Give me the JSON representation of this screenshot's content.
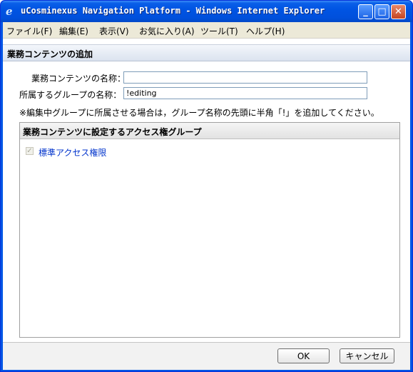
{
  "window": {
    "title": "uCosminexus Navigation Platform - Windows Internet Explorer",
    "minimize_glyph": "_",
    "maximize_glyph": "□",
    "close_glyph": "✕",
    "icon": "ie-icon"
  },
  "menubar": {
    "items": [
      "ファイル(F)",
      "編集(E)",
      "表示(V)",
      "お気に入り(A)",
      "ツール(T)",
      "ヘルプ(H)"
    ]
  },
  "dialog": {
    "title": "業務コンテンツの追加",
    "name_label": "業務コンテンツの名称：",
    "name_value": "",
    "group_label": "所属するグループの名称：",
    "group_value": "!editing",
    "note": "※編集中グループに所属させる場合は，グループ名称の先頭に半角「!」を追加してください。"
  },
  "access": {
    "header": "業務コンテンツに設定するアクセス権グループ",
    "items": [
      {
        "label": "標準アクセス権限",
        "checked": true,
        "disabled": true
      }
    ]
  },
  "footer": {
    "ok_label": "OK",
    "cancel_label": "キャンセル"
  },
  "colors": {
    "titlebar": "#0054e3",
    "link": "#0033cc"
  }
}
